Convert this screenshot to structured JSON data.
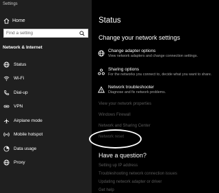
{
  "window": {
    "title": "Settings"
  },
  "sidebar": {
    "home_label": "Home",
    "search_placeholder": "Find a setting",
    "section_title": "Network & Internet",
    "items": [
      {
        "label": "Status",
        "icon": "globe-icon"
      },
      {
        "label": "Wi-Fi",
        "icon": "wifi-icon"
      },
      {
        "label": "Dial-up",
        "icon": "phone-icon"
      },
      {
        "label": "VPN",
        "icon": "vpn-icon"
      },
      {
        "label": "Airplane mode",
        "icon": "airplane-icon"
      },
      {
        "label": "Mobile hotspot",
        "icon": "hotspot-icon"
      },
      {
        "label": "Data usage",
        "icon": "data-usage-icon"
      },
      {
        "label": "Proxy",
        "icon": "globe-icon"
      }
    ]
  },
  "main": {
    "title": "Status",
    "subtitle": "Change your network settings",
    "options": [
      {
        "title": "Change adapter options",
        "description": "View network adapters and change connection settings.",
        "icon": "adapter-icon"
      },
      {
        "title": "Sharing options",
        "description": "For the networks you connect to, decide what you want to share.",
        "icon": "sharing-icon"
      },
      {
        "title": "Network troubleshooter",
        "description": "Diagnose and fix network problems.",
        "icon": "warning-icon"
      }
    ],
    "links": [
      "View your network properties",
      "Windows Firewall",
      "Network and Sharing Center",
      "Network reset"
    ],
    "question_title": "Have a question?",
    "help_links": [
      "Setting up IP address",
      "Troubleshooting network connection issues",
      "Updating network adapter or driver",
      "Get help"
    ]
  },
  "colors": {
    "sidebar_bg": "#1f1f1f",
    "main_bg": "#000000",
    "text": "#ffffff",
    "description": "#a6a6a6",
    "dim_link": "#5a5a5a"
  }
}
